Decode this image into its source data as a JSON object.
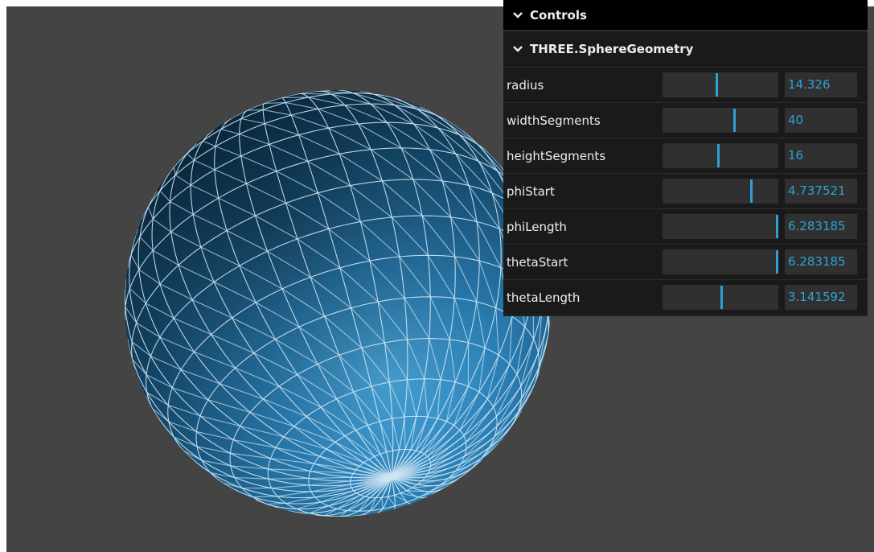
{
  "gui": {
    "controls_title": "Controls",
    "folder_title": "THREE.SphereGeometry",
    "params": [
      {
        "name": "radius",
        "value": "14.326",
        "fraction": 0.46
      },
      {
        "name": "widthSegments",
        "value": "40",
        "fraction": 0.61
      },
      {
        "name": "heightSegments",
        "value": "16",
        "fraction": 0.47
      },
      {
        "name": "phiStart",
        "value": "4.737521",
        "fraction": 0.76
      },
      {
        "name": "phiLength",
        "value": "6.283185",
        "fraction": 1.0
      },
      {
        "name": "thetaStart",
        "value": "6.283185",
        "fraction": 1.0
      },
      {
        "name": "thetaLength",
        "value": "3.141592",
        "fraction": 0.5
      }
    ]
  },
  "colors": {
    "viewport_bg": "#444444",
    "panel_bg": "#1a1a1a",
    "accent": "#2fa1d6",
    "sphere_base": "#1f6e9e",
    "wire": "#cfe6f5"
  },
  "icons": [
    "chevron-down-icon"
  ]
}
